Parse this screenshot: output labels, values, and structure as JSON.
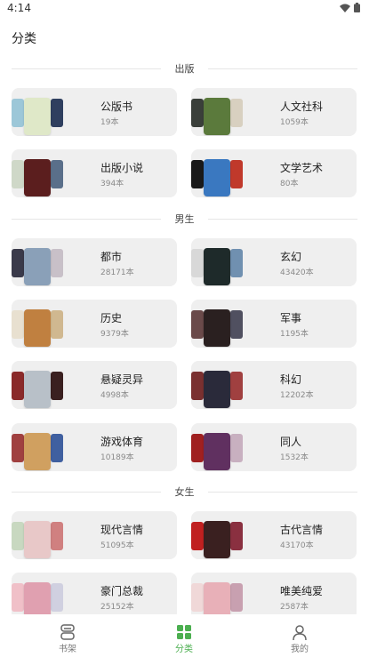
{
  "status": {
    "time": "4:14"
  },
  "page_title": "分类",
  "colors": {
    "accent": "#4caf50",
    "card_bg": "#efefef"
  },
  "sections": [
    {
      "label": "出版",
      "items": [
        {
          "name": "公版书",
          "count": "19本",
          "cover_colors": [
            "#9cc7d8",
            "#dfe8c8",
            "#2f3f5f"
          ]
        },
        {
          "name": "人文社科",
          "count": "1059本",
          "cover_colors": [
            "#3a3f3a",
            "#5b7a3c",
            "#d8d0c0"
          ]
        },
        {
          "name": "出版小说",
          "count": "394本",
          "cover_colors": [
            "#cfd8c8",
            "#5b1e1e",
            "#5a6f8a"
          ]
        },
        {
          "name": "文学艺术",
          "count": "80本",
          "cover_colors": [
            "#1a1a1a",
            "#3a78c0",
            "#c0392b"
          ]
        }
      ]
    },
    {
      "label": "男生",
      "items": [
        {
          "name": "都市",
          "count": "28171本",
          "cover_colors": [
            "#3a3a4a",
            "#8aa0b8",
            "#c8c0c8"
          ]
        },
        {
          "name": "玄幻",
          "count": "43420本",
          "cover_colors": [
            "#d8d8d8",
            "#1e2a2a",
            "#7090b0"
          ]
        },
        {
          "name": "历史",
          "count": "9379本",
          "cover_colors": [
            "#e8e0d0",
            "#c08040",
            "#d0b890"
          ]
        },
        {
          "name": "军事",
          "count": "1195本",
          "cover_colors": [
            "#6a4a4a",
            "#2a2020",
            "#505060"
          ]
        },
        {
          "name": "悬疑灵异",
          "count": "4998本",
          "cover_colors": [
            "#8a2a2a",
            "#b8c0c8",
            "#3a2020"
          ]
        },
        {
          "name": "科幻",
          "count": "12202本",
          "cover_colors": [
            "#7a3030",
            "#2a2a3a",
            "#a04040"
          ]
        },
        {
          "name": "游戏体育",
          "count": "10189本",
          "cover_colors": [
            "#a04040",
            "#d0a060",
            "#4060a0"
          ]
        },
        {
          "name": "同人",
          "count": "1532本",
          "cover_colors": [
            "#a02020",
            "#603060",
            "#c8b0c0"
          ]
        }
      ]
    },
    {
      "label": "女生",
      "items": [
        {
          "name": "现代言情",
          "count": "51095本",
          "cover_colors": [
            "#c8d8c0",
            "#e8c8c8",
            "#d08080"
          ]
        },
        {
          "name": "古代言情",
          "count": "43170本",
          "cover_colors": [
            "#c02020",
            "#3a2020",
            "#8a3040"
          ]
        },
        {
          "name": "豪门总裁",
          "count": "25152本",
          "cover_colors": [
            "#f0c0c8",
            "#e0a0b0",
            "#d0d0e0"
          ]
        },
        {
          "name": "唯美纯爱",
          "count": "2587本",
          "cover_colors": [
            "#f0d8d8",
            "#e8b0b8",
            "#c8a0b0"
          ]
        }
      ]
    }
  ],
  "bottom_nav": [
    {
      "label": "书架",
      "icon": "bookshelf-icon",
      "active": false
    },
    {
      "label": "分类",
      "icon": "category-grid-icon",
      "active": true
    },
    {
      "label": "我的",
      "icon": "user-icon",
      "active": false
    }
  ]
}
